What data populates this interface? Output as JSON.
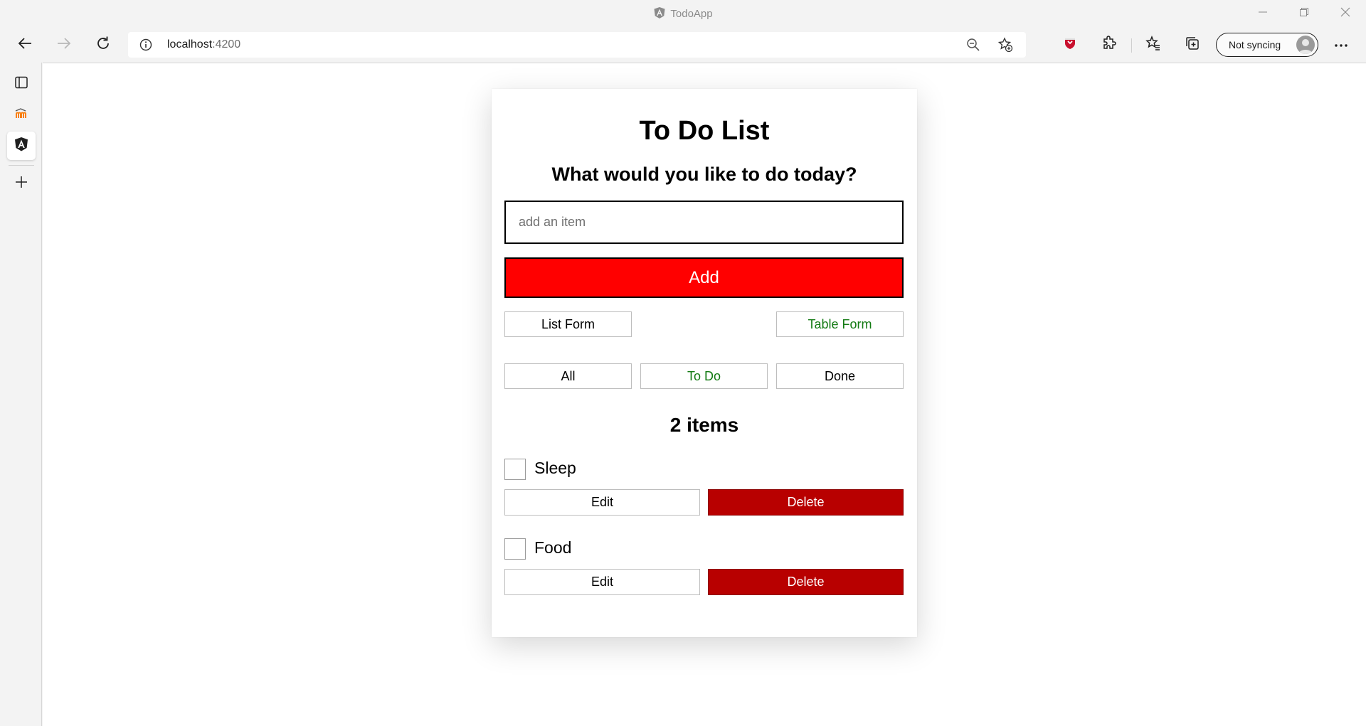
{
  "window": {
    "title": "TodoApp"
  },
  "browser": {
    "url_host": "localhost",
    "url_port": ":4200",
    "sync_label": "Not syncing"
  },
  "app": {
    "title": "To Do List",
    "subtitle": "What would you like to do today?",
    "input": {
      "placeholder": "add an item",
      "value": ""
    },
    "add_label": "Add",
    "view_toggle": {
      "list_label": "List Form",
      "table_label": "Table Form",
      "selected": "Table Form"
    },
    "filters": {
      "all_label": "All",
      "todo_label": "To Do",
      "done_label": "Done",
      "selected": "To Do"
    },
    "count_label": "2 items",
    "items": [
      {
        "label": "Sleep",
        "checked": false,
        "edit_label": "Edit",
        "delete_label": "Delete"
      },
      {
        "label": "Food",
        "checked": false,
        "edit_label": "Edit",
        "delete_label": "Delete"
      }
    ]
  },
  "colors": {
    "add_button": "#ff0000",
    "delete_button": "#b80000",
    "selected_text": "#127a12"
  },
  "icons": [
    "angular-icon",
    "back-arrow-icon",
    "forward-arrow-icon",
    "refresh-icon",
    "info-icon",
    "zoom-out-icon",
    "add-favorite-icon",
    "shield-extension-icon",
    "extensions-icon",
    "favorites-icon",
    "collections-icon",
    "profile-avatar-icon",
    "more-icon",
    "tabs-icon",
    "moodle-icon",
    "add-icon",
    "minimize-icon",
    "restore-icon",
    "close-icon"
  ]
}
